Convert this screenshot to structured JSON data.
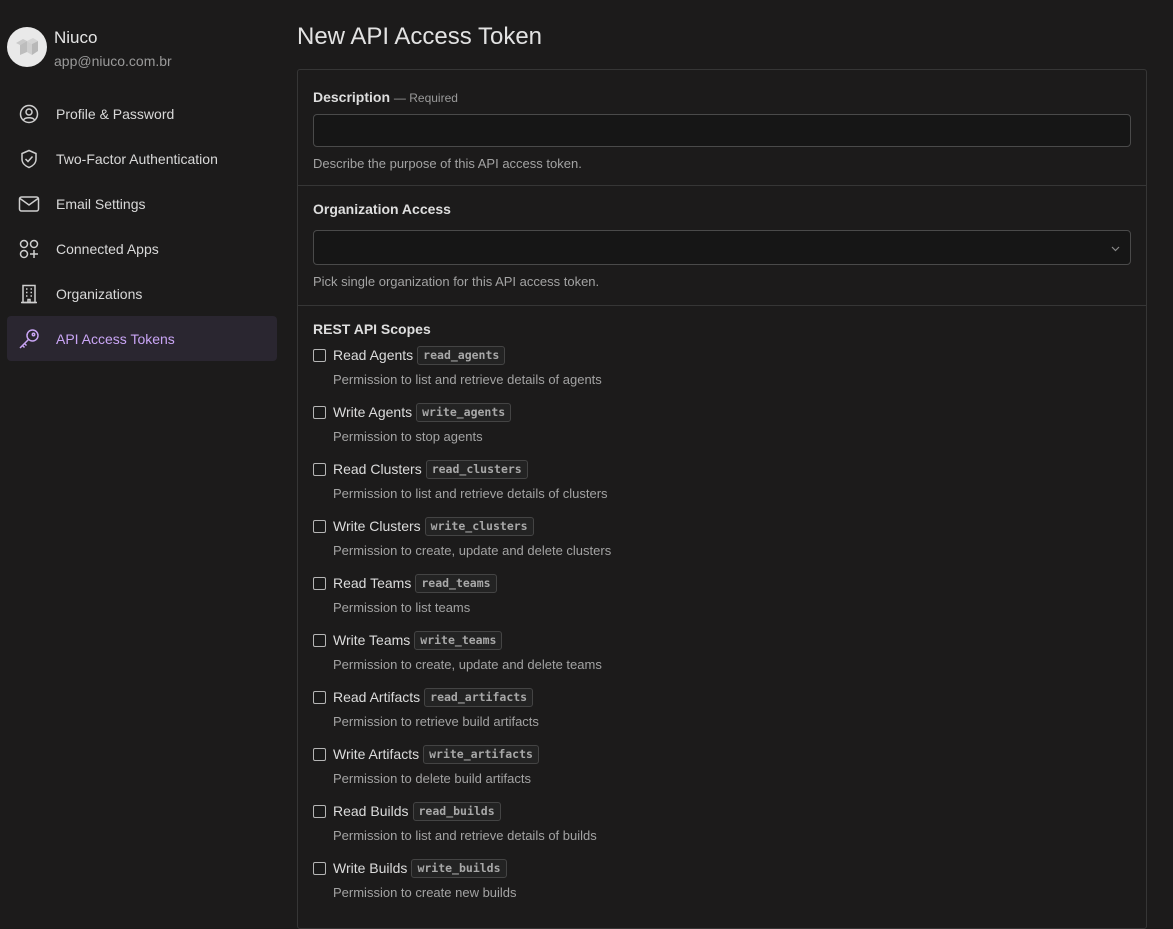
{
  "user": {
    "name": "Niuco",
    "email": "app@niuco.com.br"
  },
  "sidebar": {
    "items": [
      {
        "label": "Profile & Password",
        "icon": "user-circle-icon"
      },
      {
        "label": "Two-Factor Authentication",
        "icon": "shield-check-icon"
      },
      {
        "label": "Email Settings",
        "icon": "envelope-icon"
      },
      {
        "label": "Connected Apps",
        "icon": "apps-grid-plus-icon"
      },
      {
        "label": "Organizations",
        "icon": "building-icon"
      },
      {
        "label": "API Access Tokens",
        "icon": "key-icon",
        "active": true
      }
    ],
    "active_color": "#c9a5f5"
  },
  "page": {
    "title": "New API Access Token"
  },
  "form": {
    "description": {
      "label": "Description",
      "required": "— Required",
      "value": "",
      "hint": "Describe the purpose of this API access token."
    },
    "organization": {
      "label": "Organization Access",
      "value": "",
      "hint": "Pick single organization for this API access token."
    },
    "scopes": {
      "label": "REST API Scopes",
      "items": [
        {
          "name": "Read Agents",
          "code": "read_agents",
          "desc": "Permission to list and retrieve details of agents",
          "checked": false
        },
        {
          "name": "Write Agents",
          "code": "write_agents",
          "desc": "Permission to stop agents",
          "checked": false
        },
        {
          "name": "Read Clusters",
          "code": "read_clusters",
          "desc": "Permission to list and retrieve details of clusters",
          "checked": false
        },
        {
          "name": "Write Clusters",
          "code": "write_clusters",
          "desc": "Permission to create, update and delete clusters",
          "checked": false
        },
        {
          "name": "Read Teams",
          "code": "read_teams",
          "desc": "Permission to list teams",
          "checked": false
        },
        {
          "name": "Write Teams",
          "code": "write_teams",
          "desc": "Permission to create, update and delete teams",
          "checked": false
        },
        {
          "name": "Read Artifacts",
          "code": "read_artifacts",
          "desc": "Permission to retrieve build artifacts",
          "checked": false
        },
        {
          "name": "Write Artifacts",
          "code": "write_artifacts",
          "desc": "Permission to delete build artifacts",
          "checked": false
        },
        {
          "name": "Read Builds",
          "code": "read_builds",
          "desc": "Permission to list and retrieve details of builds",
          "checked": false
        },
        {
          "name": "Write Builds",
          "code": "write_builds",
          "desc": "Permission to create new builds",
          "checked": false
        }
      ]
    }
  }
}
